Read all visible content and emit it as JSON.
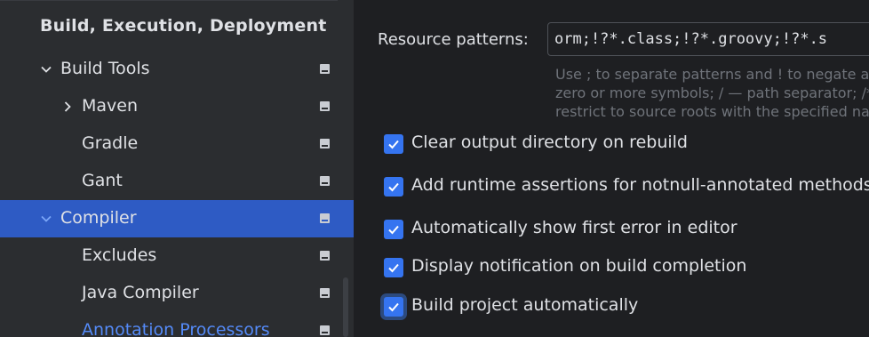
{
  "sidebar": {
    "section_title": "Build, Execution, Deployment",
    "items": [
      {
        "label": "Build Tools",
        "chevron": "down",
        "icon": "project-level-icon"
      },
      {
        "label": "Maven",
        "chevron": "right",
        "icon": "project-level-icon"
      },
      {
        "label": "Gradle",
        "chevron": "",
        "icon": "project-level-icon"
      },
      {
        "label": "Gant",
        "chevron": "",
        "icon": "project-level-icon"
      },
      {
        "label": "Compiler",
        "chevron": "down",
        "icon": "project-level-icon",
        "selected": true
      },
      {
        "label": "Excludes",
        "chevron": "",
        "icon": "project-level-icon"
      },
      {
        "label": "Java Compiler",
        "chevron": "",
        "icon": "project-level-icon"
      },
      {
        "label": "Annotation Processors",
        "chevron": "",
        "icon": "project-level-icon",
        "link": true
      }
    ]
  },
  "main": {
    "resource_patterns": {
      "label": "Resource patterns:",
      "value": "orm;!?*.class;!?*.groovy;!?*.s"
    },
    "hints": [
      "Use ; to separate patterns and ! to negate a",
      "zero or more symbols; / — path separator; /*",
      "restrict to source roots with the specified na"
    ],
    "checkboxes": [
      {
        "label": "Clear output directory on rebuild",
        "checked": true
      },
      {
        "label": "Add runtime assertions for notnull-annotated methods an",
        "checked": true
      },
      {
        "label": "Automatically show first error in editor",
        "checked": true
      },
      {
        "label": "Display notification on build completion",
        "checked": true
      },
      {
        "label": "Build project automatically",
        "checked": true,
        "focused": true
      }
    ]
  },
  "colors": {
    "sidebar_bg": "#2b2d30",
    "main_bg": "#1e1f22",
    "selection": "#2e5bc4",
    "checkbox": "#3574f0",
    "link": "#548af7",
    "hint_text": "#6f737a"
  }
}
